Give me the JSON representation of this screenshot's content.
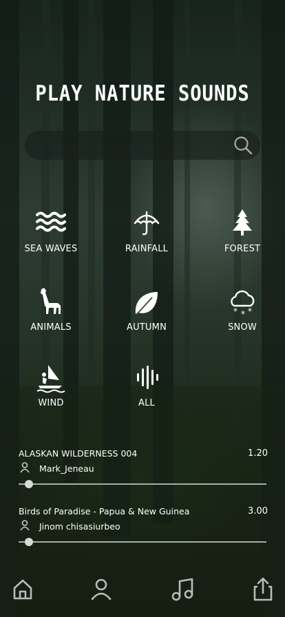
{
  "title": "Play Nature Sounds",
  "search": {
    "placeholder": "",
    "value": "",
    "icon": "search-icon"
  },
  "categories": [
    {
      "label": "SEA WAVES",
      "icon": "waves-icon"
    },
    {
      "label": "RAINFALL",
      "icon": "umbrella-icon"
    },
    {
      "label": "FOREST",
      "icon": "tree-icon"
    },
    {
      "label": "ANIMALS",
      "icon": "giraffe-icon"
    },
    {
      "label": "AUTUMN",
      "icon": "leaf-icon"
    },
    {
      "label": "SNOW",
      "icon": "snow-cloud-icon"
    },
    {
      "label": "WIND",
      "icon": "windsurf-icon"
    },
    {
      "label": "ALL",
      "icon": "soundwave-icon"
    }
  ],
  "tracks": [
    {
      "name": "ALASKAN WILDERNESS 004",
      "duration": "1.20",
      "author": "Mark_Jeneau",
      "progress": 0.03
    },
    {
      "name": "Birds of Paradise - Papua & New Guinea",
      "duration": "3.00",
      "author": "Jinom chisasiurbeo",
      "progress": 0.03
    }
  ],
  "nav": [
    {
      "icon": "home-icon"
    },
    {
      "icon": "user-icon"
    },
    {
      "icon": "music-note-icon"
    },
    {
      "icon": "share-icon"
    }
  ]
}
